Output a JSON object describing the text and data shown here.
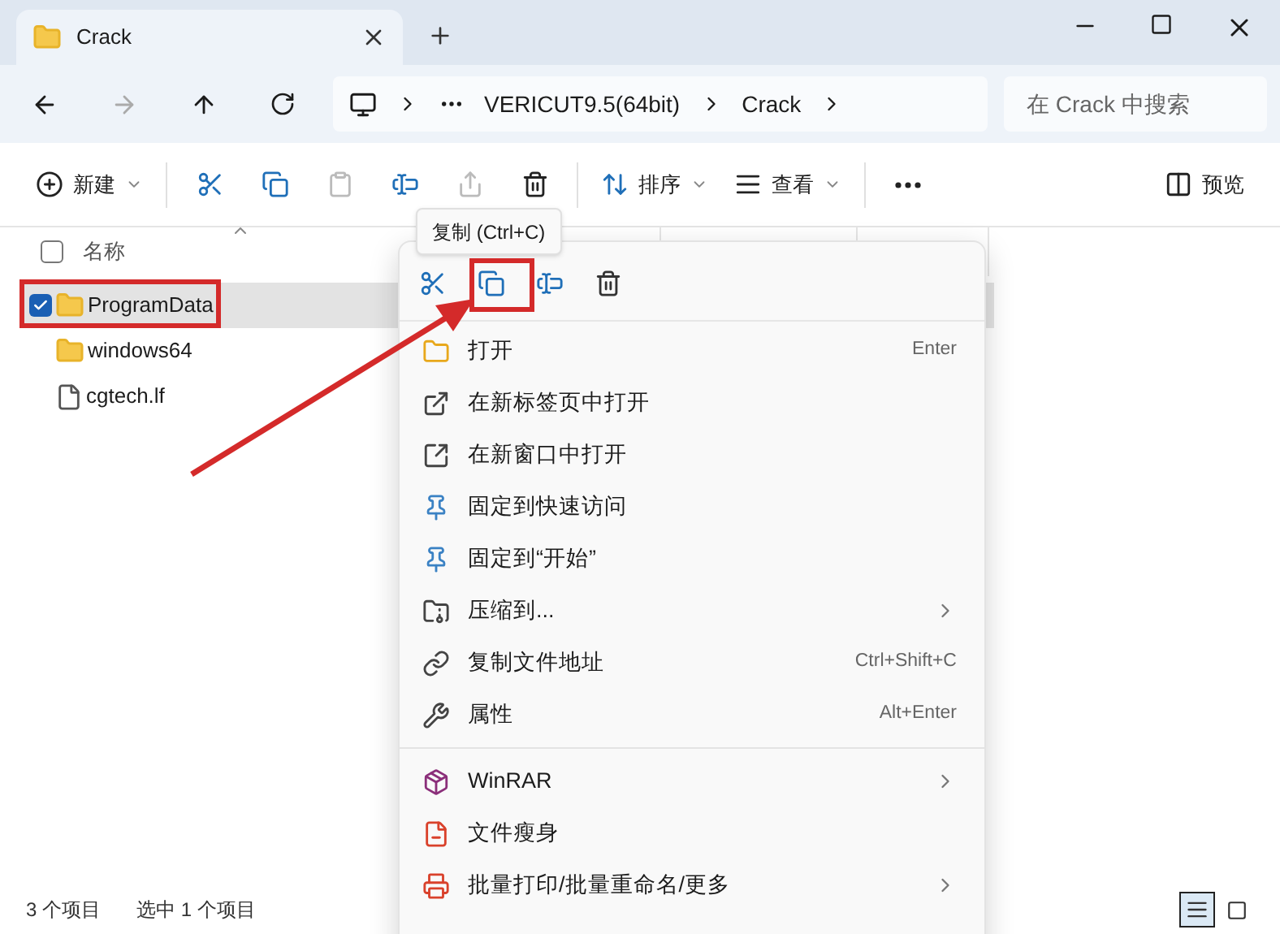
{
  "tabs": [
    {
      "label": "Crack",
      "selected": true
    }
  ],
  "address_bar": {
    "segments": [
      "VERICUT9.5(64bit)",
      "Crack"
    ]
  },
  "search": {
    "placeholder": "在 Crack 中搜索"
  },
  "toolbar": [
    {
      "label": "新建",
      "dropdown": true,
      "disabled": false
    },
    {
      "disabled": false
    },
    {
      "disabled": false
    },
    {
      "disabled": true
    },
    {
      "disabled": false
    },
    {
      "disabled": true
    },
    {
      "disabled": false
    },
    {
      "label": "排序",
      "dropdown": true,
      "disabled": false
    },
    {
      "label": "查看",
      "dropdown": true,
      "disabled": false
    },
    {
      "disabled": false
    },
    {
      "label": "预览",
      "dropdown": false,
      "disabled": false
    }
  ],
  "file_list": {
    "select_all_checked": false,
    "columns": [
      "名称"
    ],
    "rows": [
      {
        "name": "ProgramData",
        "kind": "folder",
        "selected": true
      },
      {
        "name": "windows64",
        "kind": "folder",
        "selected": false
      },
      {
        "name": "cgtech.lf",
        "kind": "file",
        "selected": false
      }
    ]
  },
  "tooltip": "复制 (Ctrl+C)",
  "context_menu": {
    "items": [
      {
        "kind": "item",
        "label": "打开",
        "shortcut": "Enter",
        "submenu": false
      },
      {
        "kind": "item",
        "label": "在新标签页中打开",
        "submenu": false
      },
      {
        "kind": "item",
        "label": "在新窗口中打开",
        "submenu": false
      },
      {
        "kind": "item",
        "label": "固定到快速访问",
        "submenu": false
      },
      {
        "kind": "item",
        "label": "固定到“开始”",
        "submenu": false
      },
      {
        "kind": "item",
        "label": "压缩到...",
        "submenu": true
      },
      {
        "kind": "item",
        "label": "复制文件地址",
        "shortcut": "Ctrl+Shift+C",
        "submenu": false
      },
      {
        "kind": "item",
        "label": "属性",
        "shortcut": "Alt+Enter",
        "submenu": false
      },
      {
        "kind": "separator"
      },
      {
        "kind": "item",
        "label": "WinRAR",
        "submenu": true
      },
      {
        "kind": "item",
        "label": "文件瘦身",
        "submenu": false
      },
      {
        "kind": "item",
        "label": "批量打印/批量重命名/更多",
        "submenu": true
      }
    ]
  },
  "status_bar": {
    "item_count": "3 个项目",
    "selection": "选中 1 个项目"
  },
  "view_buttons": [
    {
      "selected": true
    },
    {
      "selected": false
    }
  ]
}
